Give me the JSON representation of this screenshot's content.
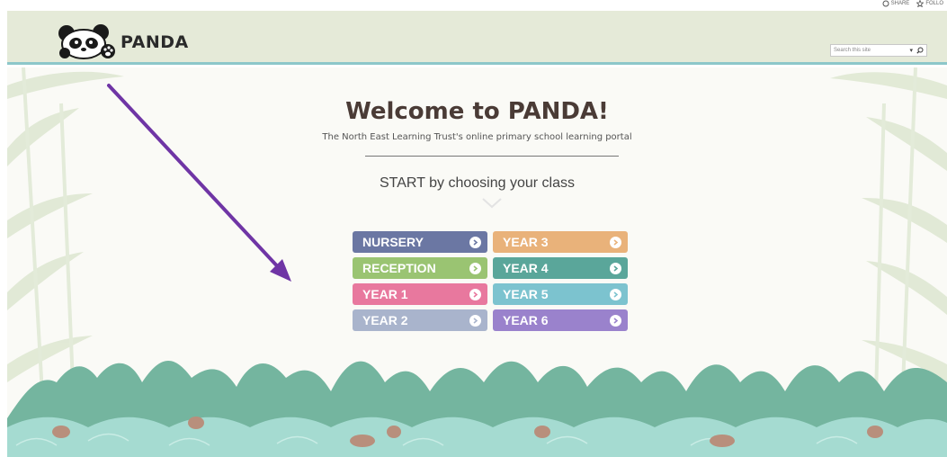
{
  "topbar": {
    "share_label": "SHARE",
    "follow_label": "FOLLO"
  },
  "header": {
    "logo_text": "PANDA",
    "search_placeholder": "Search this site"
  },
  "main": {
    "title": "Welcome to PANDA!",
    "subtitle": "The North East Learning Trust's online primary school learning portal",
    "start_text": "START by choosing your class"
  },
  "classes": [
    {
      "label": "NURSERY",
      "color": "#6b77a3"
    },
    {
      "label": "YEAR 3",
      "color": "#e9b27a"
    },
    {
      "label": "RECEPTION",
      "color": "#9ac472"
    },
    {
      "label": "YEAR 4",
      "color": "#5aa69a"
    },
    {
      "label": "YEAR 1",
      "color": "#e8789e"
    },
    {
      "label": "YEAR 5",
      "color": "#7cc3cf"
    },
    {
      "label": "YEAR 2",
      "color": "#a9b4cc"
    },
    {
      "label": "YEAR 6",
      "color": "#9a82cc"
    }
  ],
  "icons": {
    "logo": "panda-icon",
    "search": "search-icon",
    "dropdown": "dropdown-icon",
    "arrow": "arrow-circle-icon",
    "share": "share-icon",
    "follow": "follow-icon"
  },
  "colors": {
    "header_bg": "#e5ead8",
    "header_border": "#8cc7c9",
    "annotation_arrow": "#6f35a5",
    "hills": "#6fb09b",
    "waves": "#9fd6cc"
  }
}
